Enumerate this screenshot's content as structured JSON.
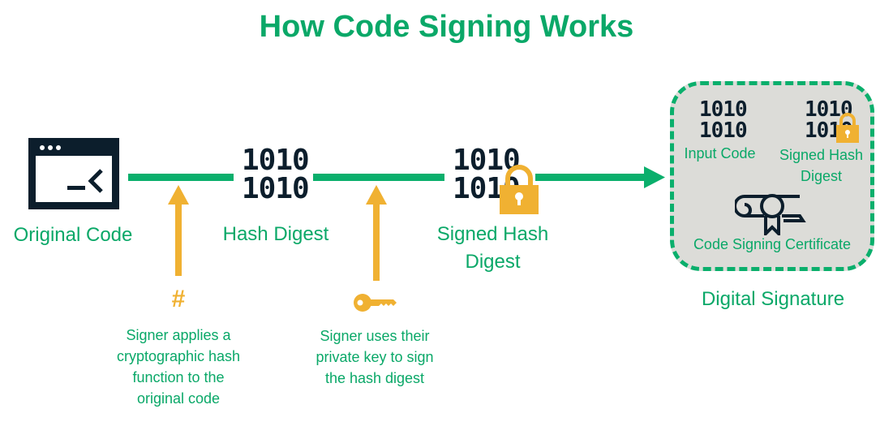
{
  "title": "How Code Signing Works",
  "colors": {
    "accent_green": "#0aaf6c",
    "accent_yellow": "#f0b132",
    "dark_navy": "#0c1e2c",
    "box_bg": "#dcdcd8"
  },
  "steps": [
    {
      "label": "Original Code",
      "icon": "terminal-window-icon"
    },
    {
      "label": "Hash Digest",
      "icon": "binary-icon",
      "binary": [
        "1010",
        "1010"
      ]
    },
    {
      "label_line1": "Signed Hash",
      "label_line2": "Digest",
      "icon": "locked-binary-icon",
      "binary": [
        "1010",
        "1010"
      ]
    }
  ],
  "actions": [
    {
      "icon": "hash-icon",
      "glyph": "#",
      "lines": [
        "Signer applies a",
        "cryptographic hash",
        "function to the",
        "original code"
      ]
    },
    {
      "icon": "key-icon",
      "lines": [
        "Signer uses their",
        "private key to sign",
        "the hash digest"
      ]
    }
  ],
  "signature_box": {
    "caption": "Digital Signature",
    "items": [
      {
        "label": "Input Code",
        "binary": [
          "1010",
          "1010"
        ]
      },
      {
        "label_line1": "Signed Hash",
        "label_line2": "Digest",
        "binary": [
          "1010",
          "1010"
        ]
      },
      {
        "label": "Code Signing Certificate"
      }
    ]
  }
}
